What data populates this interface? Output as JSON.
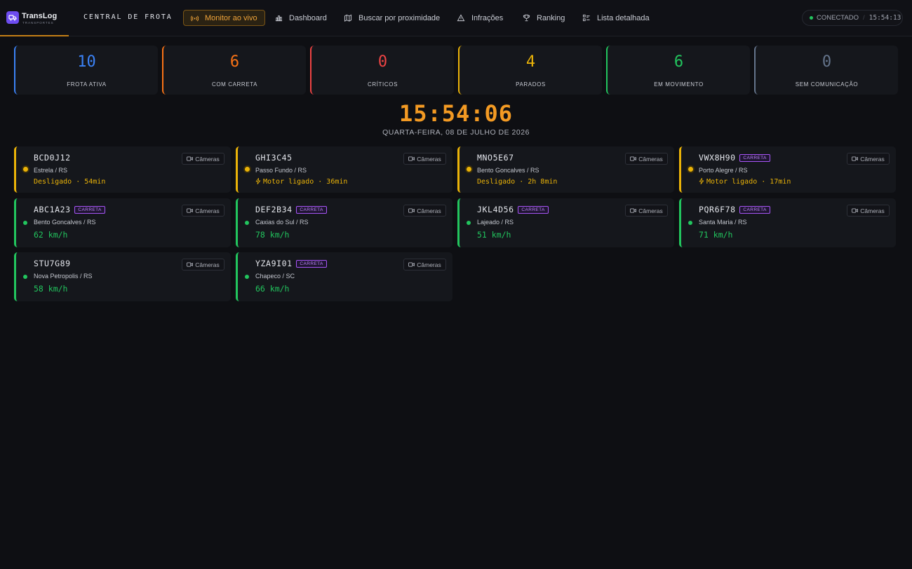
{
  "brand": {
    "name": "TransLog",
    "subtitle": "TRANSPORTES",
    "accent": "#6d4cf0"
  },
  "header": {
    "title": "CENTRAL DE FROTA"
  },
  "nav": [
    {
      "label": "Monitor ao vivo",
      "icon": "broadcast-icon",
      "active": true
    },
    {
      "label": "Dashboard",
      "icon": "bar-chart-icon"
    },
    {
      "label": "Buscar por proximidade",
      "icon": "map-icon"
    },
    {
      "label": "Infrações",
      "icon": "warning-icon"
    },
    {
      "label": "Ranking",
      "icon": "trophy-icon"
    },
    {
      "label": "Lista detalhada",
      "icon": "list-icon"
    }
  ],
  "connection": {
    "status": "CONECTADO",
    "time": "15:54:13"
  },
  "stats": [
    {
      "value": "10",
      "label": "FROTA ATIVA",
      "color": "#3b82f6"
    },
    {
      "value": "6",
      "label": "COM CARRETA",
      "color": "#f97316"
    },
    {
      "value": "0",
      "label": "CRÍTICOS",
      "color": "#ef4444"
    },
    {
      "value": "4",
      "label": "PARADOS",
      "color": "#eab308"
    },
    {
      "value": "6",
      "label": "EM MOVIMENTO",
      "color": "#22c55e"
    },
    {
      "value": "0",
      "label": "SEM COMUNICAÇÃO",
      "color": "#64748b"
    }
  ],
  "clock": {
    "time": "15:54:06",
    "date": "QUARTA-FEIRA, 08 DE JULHO DE 2026"
  },
  "cameras_label": "Câmeras",
  "badge_label": "CARRETA",
  "vehicles": [
    {
      "plate": "BCD0J12",
      "location": "Estrela / RS",
      "info": "Desligado · 54min",
      "status": "stopped",
      "carreta": false
    },
    {
      "plate": "GHI3C45",
      "location": "Passo Fundo / RS",
      "info": "Motor ligado · 36min",
      "status": "idle",
      "carreta": false
    },
    {
      "plate": "MNO5E67",
      "location": "Bento Goncalves / RS",
      "info": "Desligado · 2h 8min",
      "status": "stopped",
      "carreta": false
    },
    {
      "plate": "VWX8H90",
      "location": "Porto Alegre / RS",
      "info": "Motor ligado · 17min",
      "status": "idle",
      "carreta": true
    },
    {
      "plate": "ABC1A23",
      "location": "Bento Goncalves / RS",
      "info": "62 km/h",
      "status": "moving",
      "carreta": true
    },
    {
      "plate": "DEF2B34",
      "location": "Caxias do Sul / RS",
      "info": "78 km/h",
      "status": "moving",
      "carreta": true
    },
    {
      "plate": "JKL4D56",
      "location": "Lajeado / RS",
      "info": "51 km/h",
      "status": "moving",
      "carreta": true
    },
    {
      "plate": "PQR6F78",
      "location": "Santa Maria / RS",
      "info": "71 km/h",
      "status": "moving",
      "carreta": true
    },
    {
      "plate": "STU7G89",
      "location": "Nova Petropolis / RS",
      "info": "58 km/h",
      "status": "moving",
      "carreta": false
    },
    {
      "plate": "YZA9I01",
      "location": "Chapeco / SC",
      "info": "66 km/h",
      "status": "moving",
      "carreta": true
    }
  ],
  "colors": {
    "stopped": "#eab308",
    "moving": "#22c55e",
    "clock": "#f39a23"
  }
}
